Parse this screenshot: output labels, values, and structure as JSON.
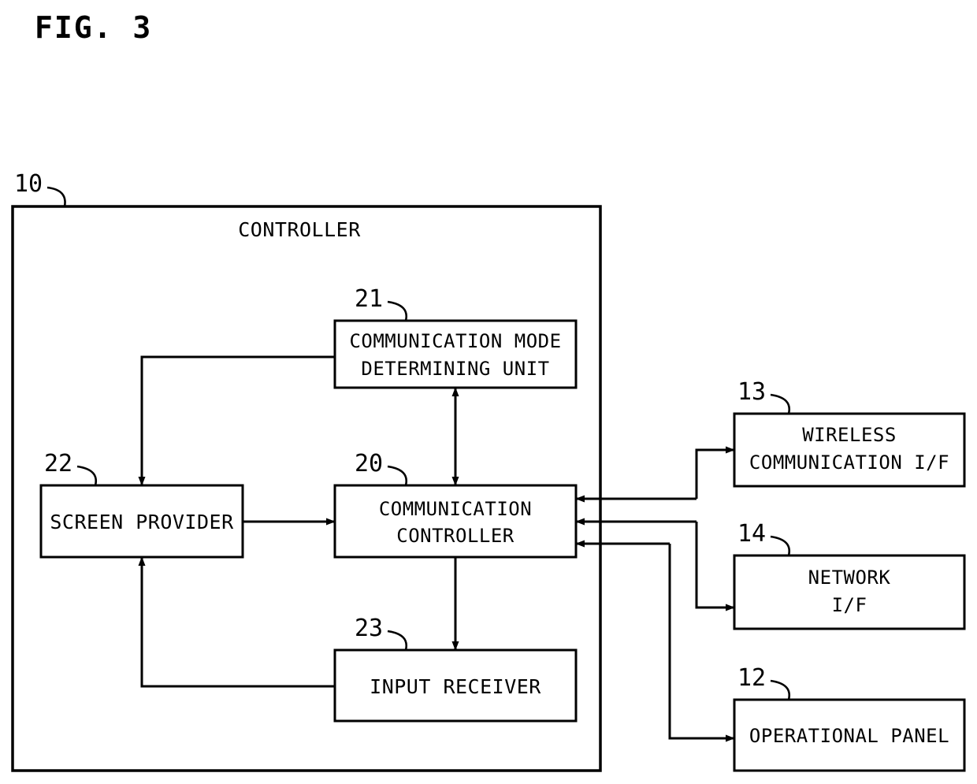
{
  "figure": {
    "title": "FIG. 3",
    "type": "patent-block-diagram"
  },
  "outer": {
    "ref": "10",
    "label": "CONTROLLER"
  },
  "blocks": [
    {
      "id": "comm-mode-determining-unit",
      "ref": "21",
      "line1": "COMMUNICATION MODE",
      "line2": "DETERMINING UNIT"
    },
    {
      "id": "screen-provider",
      "ref": "22",
      "line1": "SCREEN PROVIDER",
      "line2": ""
    },
    {
      "id": "communication-controller",
      "ref": "20",
      "line1": "COMMUNICATION",
      "line2": "CONTROLLER"
    },
    {
      "id": "input-receiver",
      "ref": "23",
      "line1": "INPUT RECEIVER",
      "line2": ""
    },
    {
      "id": "wireless-communication-if",
      "ref": "13",
      "line1": "WIRELESS",
      "line2": "COMMUNICATION I/F"
    },
    {
      "id": "network-if",
      "ref": "14",
      "line1": "NETWORK",
      "line2": "I/F"
    },
    {
      "id": "operational-panel",
      "ref": "12",
      "line1": "OPERATIONAL PANEL",
      "line2": ""
    }
  ],
  "colors": {
    "ink": "#000000",
    "paper": "#ffffff"
  }
}
